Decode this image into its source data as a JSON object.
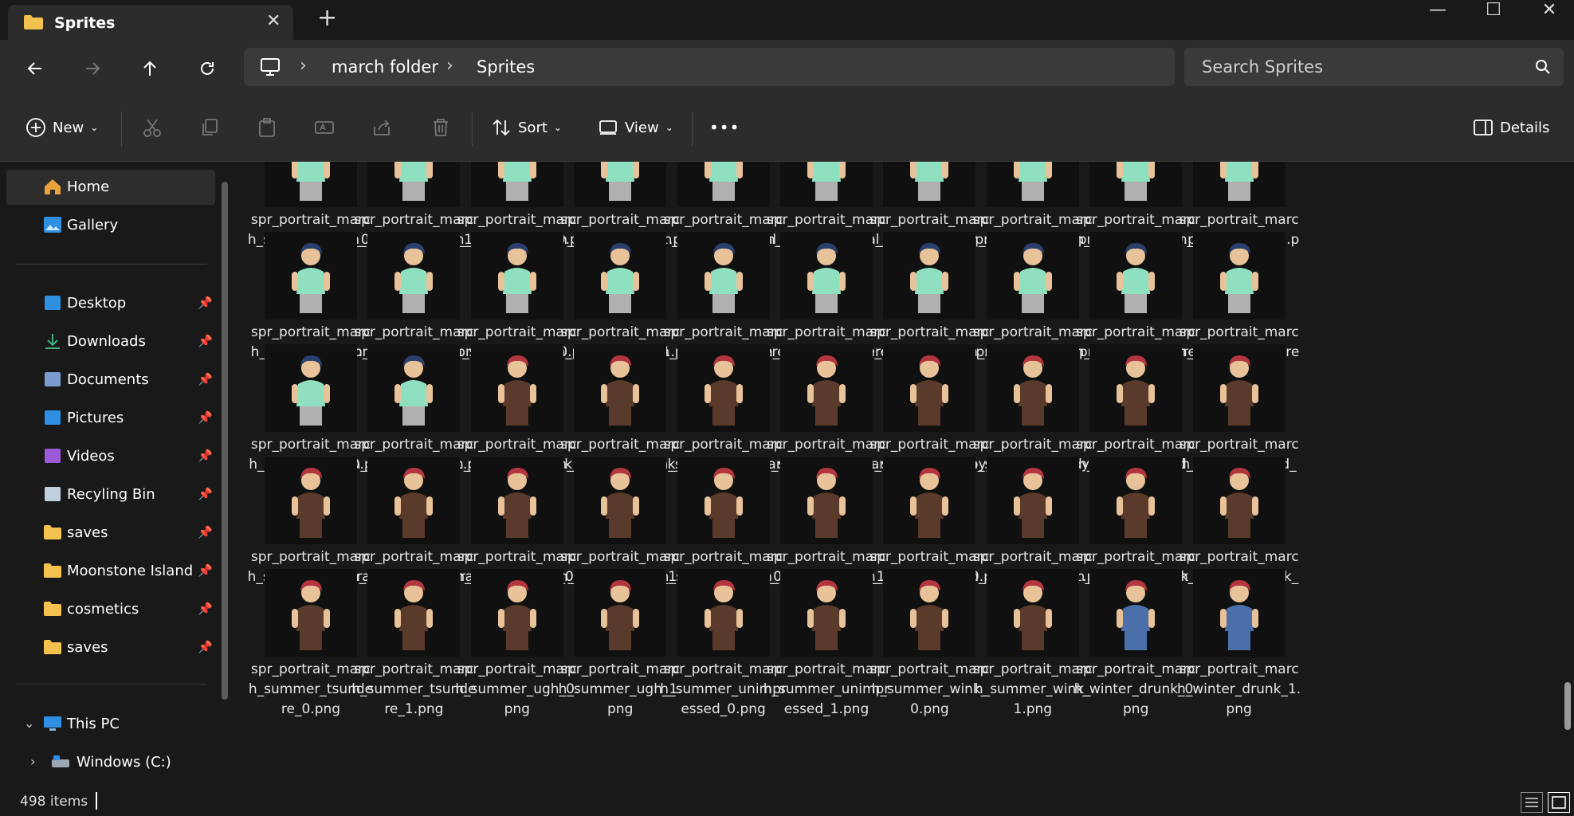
{
  "window": {
    "tab_title": "Sprites",
    "min": "—",
    "max": "☐",
    "close": "✕"
  },
  "breadcrumb": [
    "march folder",
    "Sprites"
  ],
  "search": {
    "placeholder": "Search Sprites"
  },
  "toolbar": {
    "new": "New",
    "sort": "Sort",
    "view": "View",
    "more": "•••",
    "details": "Details"
  },
  "sidebar": {
    "top": [
      {
        "label": "Home",
        "icon": "home-icon"
      },
      {
        "label": "Gallery",
        "icon": "gallery-icon"
      }
    ],
    "quick": [
      {
        "label": "Desktop",
        "icon": "desktop-icon",
        "color": "#2f8fe0"
      },
      {
        "label": "Downloads",
        "icon": "downloads-icon",
        "color": "#3bb07a"
      },
      {
        "label": "Documents",
        "icon": "documents-icon",
        "color": "#7a9ccf"
      },
      {
        "label": "Pictures",
        "icon": "pictures-icon",
        "color": "#2f8fe0"
      },
      {
        "label": "Videos",
        "icon": "videos-icon",
        "color": "#9b5ad6"
      },
      {
        "label": "Recyling Bin",
        "icon": "recycle-bin-icon",
        "color": "#bfcfe0"
      },
      {
        "label": "saves",
        "icon": "folder-icon",
        "color": "#f2c14e"
      },
      {
        "label": "Moonstone Island",
        "icon": "folder-icon",
        "color": "#f2c14e"
      },
      {
        "label": "cosmetics",
        "icon": "folder-icon",
        "color": "#f2c14e"
      },
      {
        "label": "saves",
        "icon": "folder-icon",
        "color": "#f2c14e"
      }
    ],
    "this_pc": "This PC",
    "windows_c": "Windows (C:)"
  },
  "files": [
    "spr_portrait_march_spring_happy_0.png",
    "spr_portrait_march_spring_happy_1.png",
    "spr_portrait_march_spring_mad_0.png",
    "spr_portrait_march_spring_mad_1.png",
    "spr_portrait_march_spring_neutral_0.png",
    "spr_portrait_march_spring_neutral_1.png",
    "spr_portrait_march_spring_sad_0.png",
    "spr_portrait_march_spring_sad_1.png",
    "spr_portrait_march_spring_sigh_0.png",
    "spr_portrait_march_spring_sigh_1.png",
    "spr_portrait_march_spring_sly_0.png",
    "spr_portrait_march_spring_sly_1.png",
    "spr_portrait_march_spring_think_0.png",
    "spr_portrait_march_spring_think_1.png",
    "spr_portrait_march_spring_tsundere_0.png",
    "spr_portrait_march_spring_tsundere_1.png",
    "spr_portrait_march_spring_ugh_0.png",
    "spr_portrait_march_spring_ugh_1.png",
    "spr_portrait_march_spring_unimpressed_0.png",
    "spr_portrait_march_spring_unimpressed_1.png",
    "spr_portrait_march_spring_wink_0.png",
    "spr_portrait_march_spring_wink_1.png",
    "spr_portrait_march_summer_drunk_0.png",
    "spr_portrait_march_summer_drunk_1.png",
    "spr_portrait_march_summer_embarrassed_0.png",
    "spr_portrait_march_summer_embarrassed_1.png",
    "spr_portrait_march_summer_happy_0.png",
    "spr_portrait_march_summer_happy_1.png",
    "spr_portrait_march_summer_mad_0.png",
    "spr_portrait_march_summer_mad_1.png",
    "spr_portrait_march_summer_neutral_0.png",
    "spr_portrait_march_summer_neutral_1.png",
    "spr_portrait_march_summer_sad_0.png",
    "spr_portrait_march_summer_sad_1.png",
    "spr_portrait_march_summer_sigh_0.png",
    "spr_portrait_march_summer_sigh_1.png",
    "spr_portrait_march_summer_sly_0.png",
    "spr_portrait_march_summer_sly_1.png",
    "spr_portrait_march_summer_think_0.png",
    "spr_portrait_march_summer_think_1.png",
    "spr_portrait_march_summer_tsundere_0.png",
    "spr_portrait_march_summer_tsundere_1.png",
    "spr_portrait_march_summer_ugh_0.png",
    "spr_portrait_march_summer_ugh_1.png",
    "spr_portrait_march_summer_unimpressed_0.png",
    "spr_portrait_march_summer_unimpressed_1.png",
    "spr_portrait_march_summer_wink_0.png",
    "spr_portrait_march_summer_wink_1.png",
    "spr_portrait_march_winter_drunk_0.png",
    "spr_portrait_march_winter_drunk_1.png"
  ],
  "colors": {
    "spring_hair": "#2a3f6e",
    "spring_shirt": "#8fe0c0",
    "summer_hair": "#b3353f",
    "summer_apron": "#5a3a2a",
    "winter_outfit": "#4b6fa8",
    "skin": "#e8c39a"
  },
  "status": {
    "count": "498 items"
  }
}
